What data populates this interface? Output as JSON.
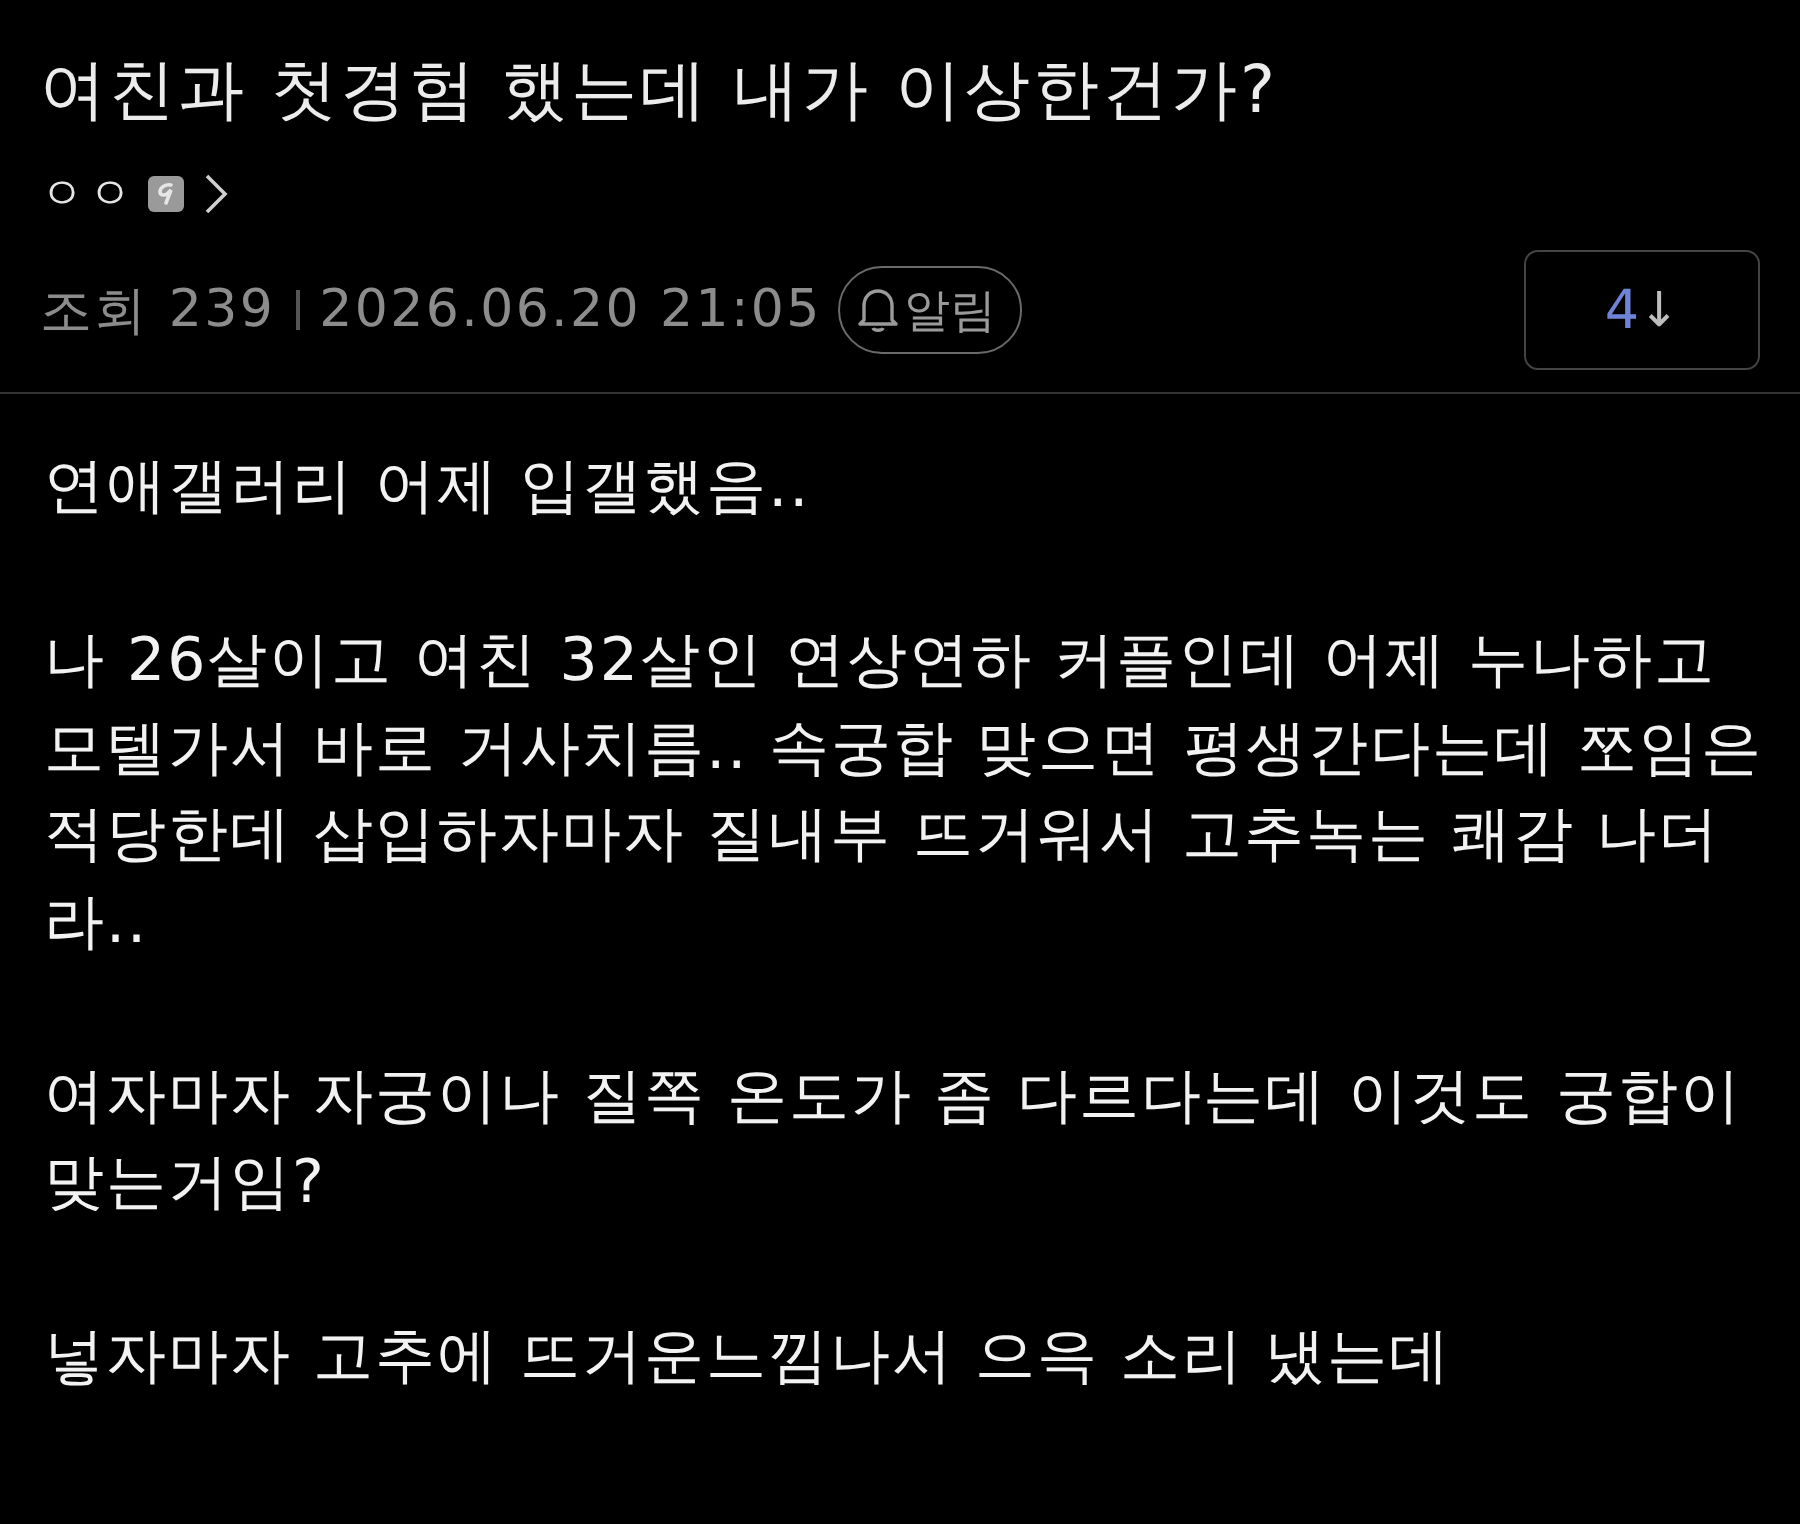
{
  "post": {
    "title": "여친과 첫경험 했는데 내가 이상한건가?",
    "author": {
      "name": "ㅇㅇ"
    },
    "views_label": "조회",
    "views": "239",
    "date": "2026.06.20 21:05",
    "alert_button": "알림",
    "comment_button": {
      "count": "4",
      "arrow": "↓"
    }
  },
  "body": {
    "paragraphs": [
      "연애갤러리 어제 입갤했음..",
      "나 26살이고 여친 32살인 연상연하 커플인데 어제 누나하고 모텔가서 바로 거사치름.. 속궁합 맞으면 평생간다는데 쪼임은 적당한데 삽입하자마자 질내부 뜨거워서 고추녹는 쾌감 나더라..",
      "여자마자 자궁이나 질쪽 온도가 좀 다르다는데 이것도 궁합이 맞는거임?",
      "넣자마자 고추에 뜨거운느낌나서 으윽 소리 냈는데"
    ]
  }
}
